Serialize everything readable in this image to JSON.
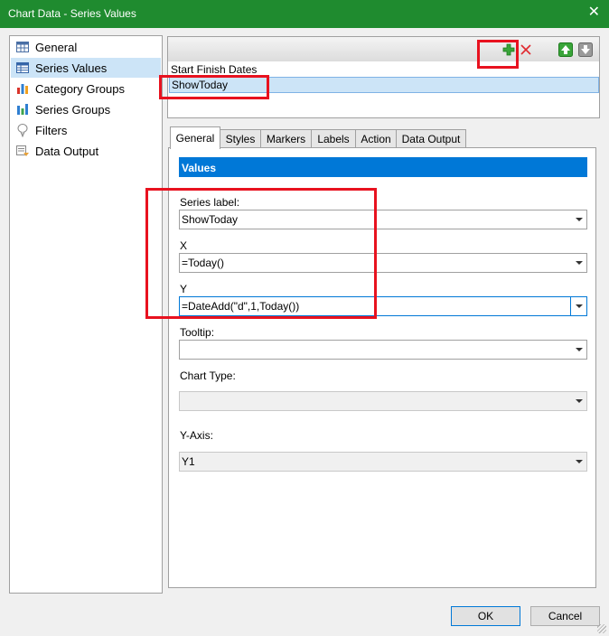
{
  "window": {
    "title": "Chart Data - Series Values",
    "close_glyph": "✕"
  },
  "nav": {
    "items": [
      {
        "label": "General",
        "icon": "grid-icon",
        "selected": false
      },
      {
        "label": "Series Values",
        "icon": "table-icon",
        "selected": true
      },
      {
        "label": "Category Groups",
        "icon": "bar-chart-icon",
        "selected": false
      },
      {
        "label": "Series Groups",
        "icon": "bar-chart-icon",
        "selected": false
      },
      {
        "label": "Filters",
        "icon": "filter-icon",
        "selected": false
      },
      {
        "label": "Data Output",
        "icon": "data-output-icon",
        "selected": false
      }
    ]
  },
  "series_list": {
    "group_header": "Start Finish Dates",
    "selected_item": "ShowToday",
    "toolbar": [
      "add-icon",
      "delete-icon",
      "move-up-icon",
      "move-down-icon"
    ]
  },
  "tabs": [
    "General",
    "Styles",
    "Markers",
    "Labels",
    "Action",
    "Data Output"
  ],
  "active_tab": "General",
  "section_title": "Values",
  "fields": {
    "series_label": {
      "label": "Series label:",
      "value": "ShowToday"
    },
    "x": {
      "label": "X",
      "value": "=Today()"
    },
    "y": {
      "label": "Y",
      "value": "=DateAdd(\"d\",1,Today())"
    },
    "tooltip": {
      "label": "Tooltip:",
      "value": ""
    },
    "chart_type": {
      "label": "Chart Type:",
      "value": ""
    },
    "y_axis": {
      "label": "Y-Axis:",
      "value": "Y1"
    }
  },
  "buttons": {
    "ok": "OK",
    "cancel": "Cancel"
  },
  "colors": {
    "titlebar": "#1f8b2f",
    "accent": "#0078d7",
    "annotation": "#e8121f",
    "selection": "#cce4f7"
  }
}
